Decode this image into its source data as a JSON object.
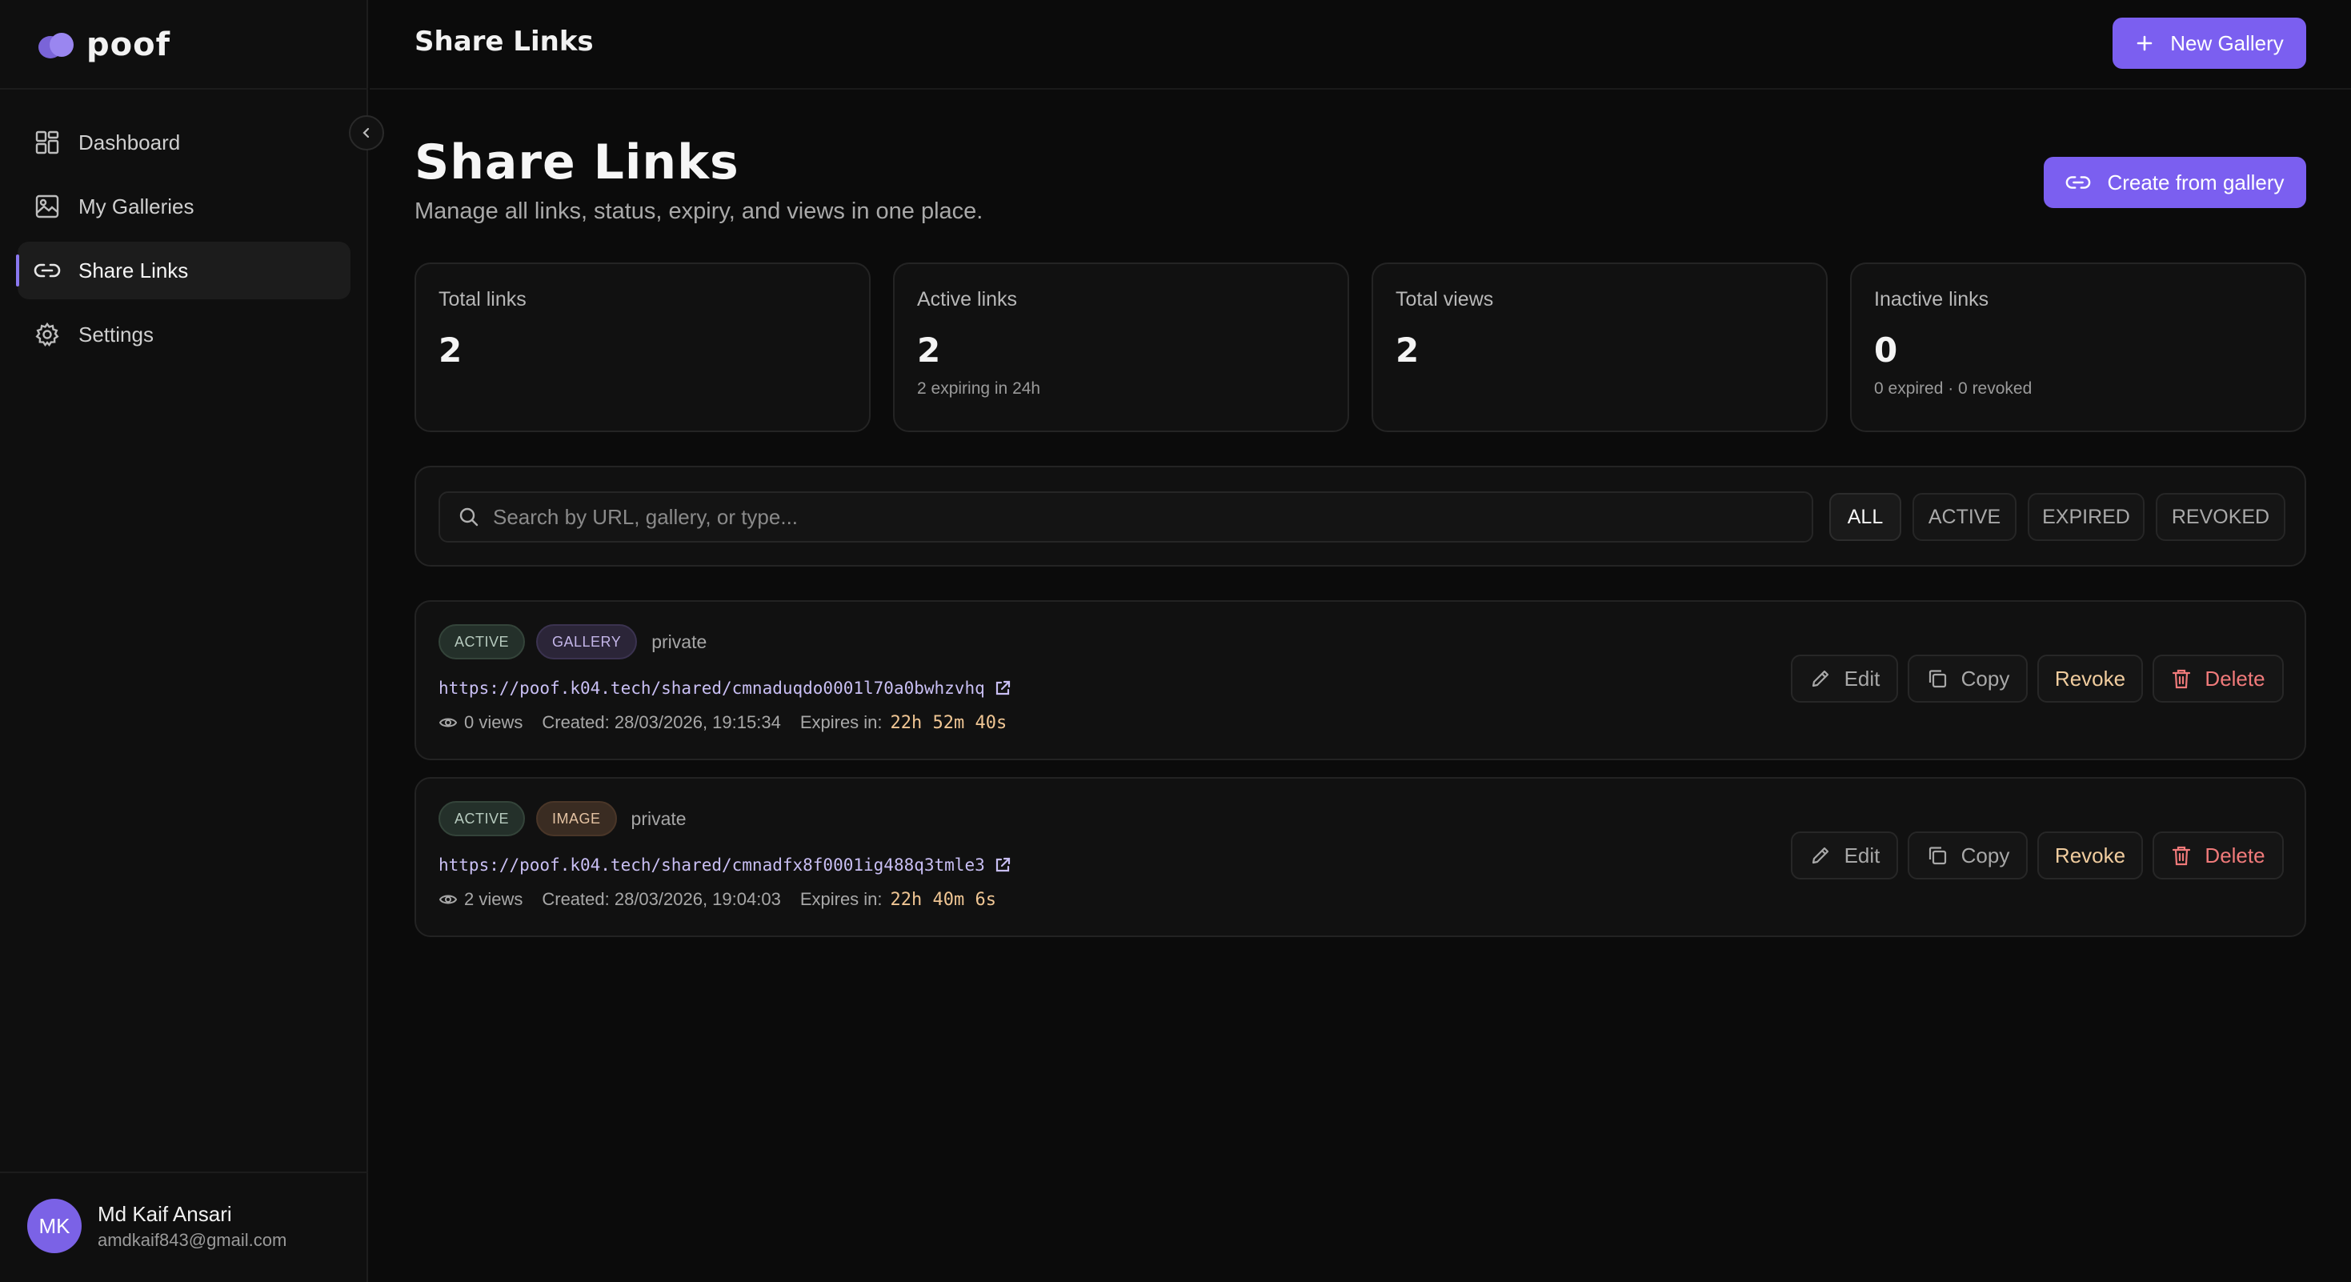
{
  "app": {
    "name": "poof"
  },
  "sidebar": {
    "items": [
      {
        "label": "Dashboard",
        "icon": "dashboard-icon",
        "active": false
      },
      {
        "label": "My Galleries",
        "icon": "image-icon",
        "active": false
      },
      {
        "label": "Share Links",
        "icon": "link-icon",
        "active": true
      },
      {
        "label": "Settings",
        "icon": "gear-icon",
        "active": false
      }
    ],
    "user": {
      "initials": "MK",
      "name": "Md Kaif Ansari",
      "email": "amdkaif843@gmail.com"
    }
  },
  "topbar": {
    "title": "Share Links",
    "new_gallery_label": "New Gallery"
  },
  "header": {
    "title": "Share Links",
    "subtitle": "Manage all links, status, expiry, and views in one place.",
    "create_label": "Create from gallery"
  },
  "stats": [
    {
      "label": "Total links",
      "value": "2",
      "note": ""
    },
    {
      "label": "Active links",
      "value": "2",
      "note": "2 expiring in 24h"
    },
    {
      "label": "Total views",
      "value": "2",
      "note": ""
    },
    {
      "label": "Inactive links",
      "value": "0",
      "note": "0 expired · 0 revoked"
    }
  ],
  "filter": {
    "search_placeholder": "Search by URL, gallery, or type...",
    "chips": [
      "ALL",
      "ACTIVE",
      "EXPIRED",
      "REVOKED"
    ],
    "selected": "ALL"
  },
  "links": [
    {
      "status": "ACTIVE",
      "type": "GALLERY",
      "privacy": "private",
      "url": "https://poof.k04.tech/shared/cmnaduqdo0001l70a0bwhzvhq",
      "views": "0 views",
      "created": "Created: 28/03/2026, 19:15:34",
      "expires_label": "Expires in:",
      "expires_value": "22h 52m 40s"
    },
    {
      "status": "ACTIVE",
      "type": "IMAGE",
      "privacy": "private",
      "url": "https://poof.k04.tech/shared/cmnadfx8f0001ig488q3tmle3",
      "views": "2 views",
      "created": "Created: 28/03/2026, 19:04:03",
      "expires_label": "Expires in:",
      "expires_value": "22h 40m 6s"
    }
  ],
  "actions": {
    "edit": "Edit",
    "copy": "Copy",
    "revoke": "Revoke",
    "delete": "Delete"
  },
  "colors": {
    "accent": "#7b5ff0",
    "revoke": "#f0cc9e",
    "delete": "#f07a7a",
    "countdown": "#f0c694"
  }
}
